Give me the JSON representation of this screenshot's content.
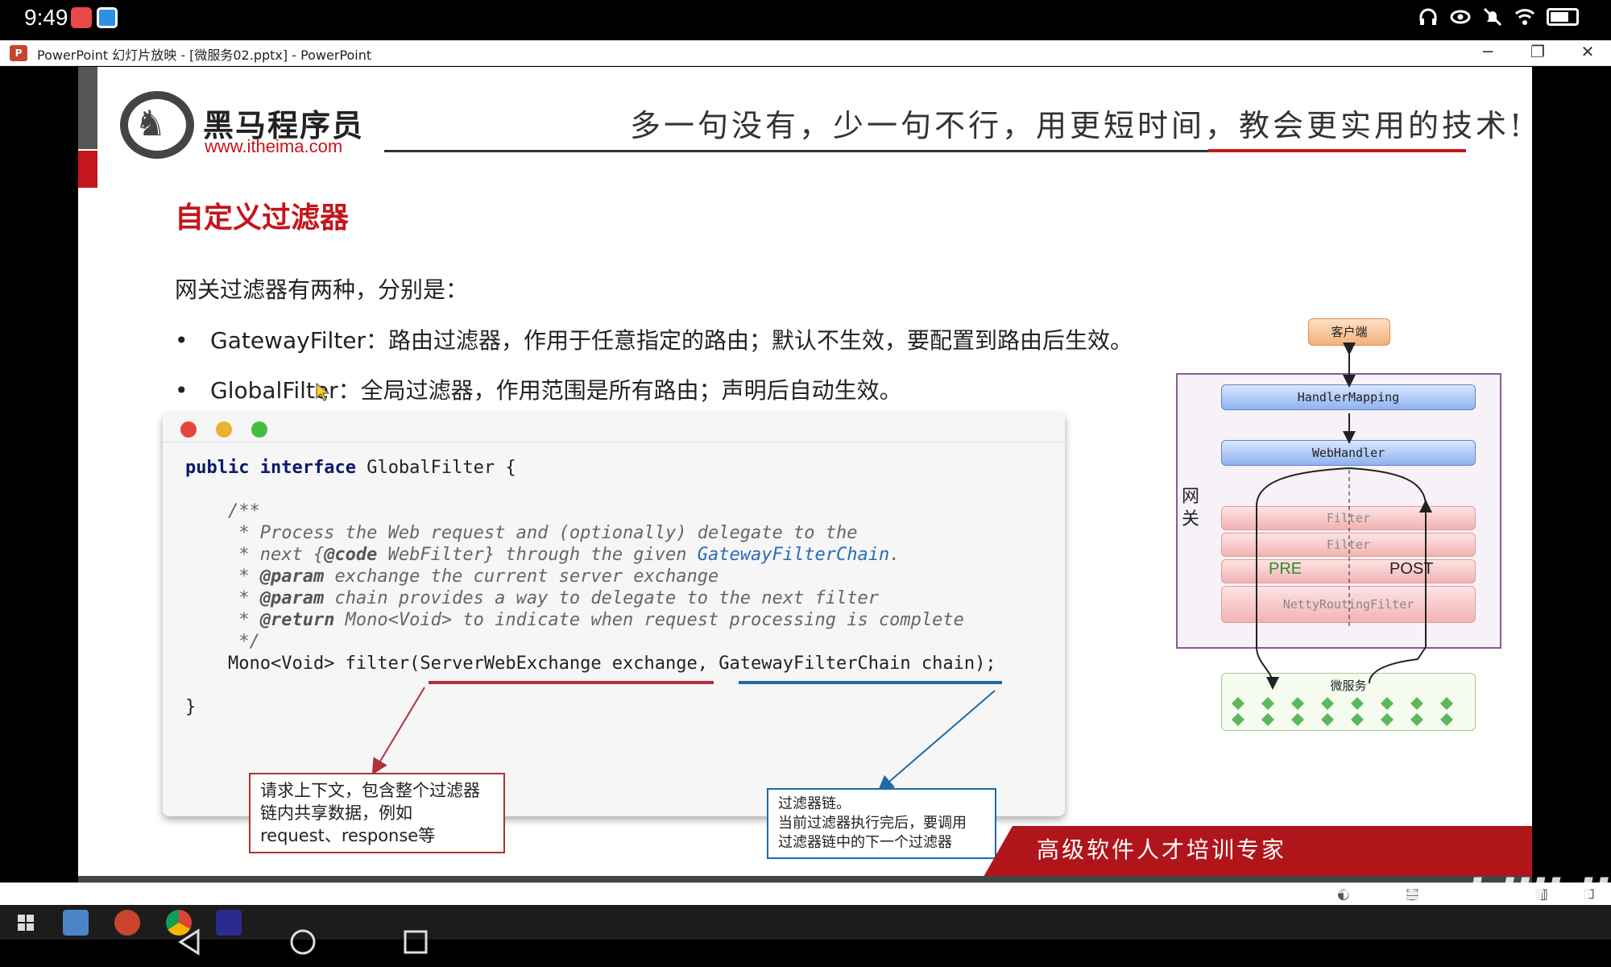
{
  "status_bar": {
    "time": "9:49"
  },
  "window": {
    "title": "PowerPoint 幻灯片放映 - [微服务02.pptx] - PowerPoint",
    "app_icon": "P",
    "minimize": "─",
    "restore": "❐",
    "close": "✕"
  },
  "slide": {
    "logo_name": "黑马程序员",
    "logo_url": "www.itheima.com",
    "slogan": "多一句没有，少一句不行，用更短时间，教会更实用的技术!",
    "title": "自定义过滤器",
    "intro": "网关过滤器有两种，分别是：",
    "bullets": [
      {
        "dot": "•",
        "text": "GatewayFilter：路由过滤器，作用于任意指定的路由；默认不生效，要配置到路由后生效。"
      },
      {
        "dot": "•",
        "text": "GlobalFilter：全局过滤器，作用范围是所有路由；声明后自动生效。"
      }
    ],
    "code": {
      "line1_kw1": "public",
      "line1_kw2": "interface",
      "line1_rest": " GlobalFilter {",
      "c_open": "    /**",
      "c1": "     * Process the Web request and (optionally) delegate to the",
      "c2a": "     * next {",
      "c2b": "@code",
      "c2c": " WebFilter} through the given ",
      "c2d": "GatewayFilterChain",
      "c2e": ".",
      "c3a": "     * ",
      "c3b": "@param",
      "c3c": " exchange the current server exchange",
      "c4a": "     * ",
      "c4b": "@param",
      "c4c": " chain provides a way to delegate to the next filter",
      "c5a": "     * ",
      "c5b": "@return",
      "c5c": " Mono<Void> to indicate when request processing is complete",
      "c_close": "     */",
      "method": "    Mono<Void> filter(ServerWebExchange exchange, GatewayFilterChain chain);",
      "end": "}"
    },
    "note_left": {
      "line1": "请求上下文，包含整个过滤器",
      "line2": "链内共享数据，例如",
      "line3": "request、response等"
    },
    "note_right": {
      "line1": "过滤器链。",
      "line2": "当前过滤器执行完后，要调用",
      "line3": "过滤器链中的下一个过滤器"
    },
    "diagram": {
      "client": "客户端",
      "handler_mapping": "HandlerMapping",
      "web_handler": "WebHandler",
      "gateway_label_1": "网",
      "gateway_label_2": "关",
      "filter1": "Filter",
      "filter2": "Filter",
      "pre": "PRE",
      "post": "POST",
      "netty": "NettyRoutingFilter",
      "microservice": "微服务"
    },
    "brand_footer": "高级软件人才培训专家"
  },
  "overlay": {
    "watermark": "黑马程序员",
    "bilibili": "bilibili"
  },
  "colors": {
    "brand_red": "#c4161c",
    "code_keyword": "#0b1a6b",
    "link_blue": "#2c6cb5"
  }
}
